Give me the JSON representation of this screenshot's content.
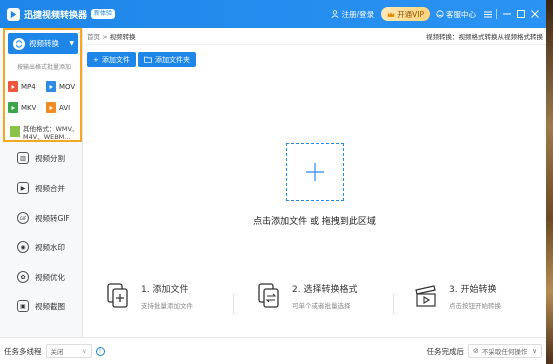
{
  "titlebar": {
    "app_title": "迅捷视频转换器",
    "badge": "新体验",
    "login": "注册/登录",
    "vip": "开通VIP",
    "help": "客服中心"
  },
  "sidebar": {
    "active_item": "视频转换",
    "batch_hint": "按输出格式批量添加",
    "formats": [
      "MP4",
      "MOV",
      "MKV",
      "AVI"
    ],
    "other_formats": "其他格式：WMV、M4V、WEBM...",
    "items": [
      {
        "label": "视频分割",
        "icon": "split-icon"
      },
      {
        "label": "视频合并",
        "icon": "play-icon"
      },
      {
        "label": "视频转GIF",
        "icon": "gif-icon"
      },
      {
        "label": "视频水印",
        "icon": "watermark-icon"
      },
      {
        "label": "视频优化",
        "icon": "optimize-icon"
      },
      {
        "label": "视频截图",
        "icon": "screenshot-icon"
      }
    ]
  },
  "main": {
    "breadcrumb_home": "首页",
    "breadcrumb_sep": ">",
    "breadcrumb_current": "视频转换",
    "breadcrumb_desc": "视频转换：视频格式转换从视频格式转换",
    "add_file_btn": "添加文件",
    "add_folder_btn": "添加文件夹",
    "drop_label": "点击添加文件 或 拖拽到此区域",
    "steps": [
      {
        "title": "1. 添加文件",
        "sub": "支持批量添加文件"
      },
      {
        "title": "2. 选择转换格式",
        "sub": "可单个或者批量选择"
      },
      {
        "title": "3. 开始转换",
        "sub": "点击按钮开始转换"
      }
    ]
  },
  "bottombar": {
    "multi_label": "任务多线程",
    "multi_value": "关闭",
    "complete_label": "任务完成后",
    "complete_value": "不采取任何操作"
  },
  "colors": {
    "brand_blue": "#1d86e8",
    "highlight_orange": "#f5a623",
    "vip_gold": "#ffd27a"
  }
}
